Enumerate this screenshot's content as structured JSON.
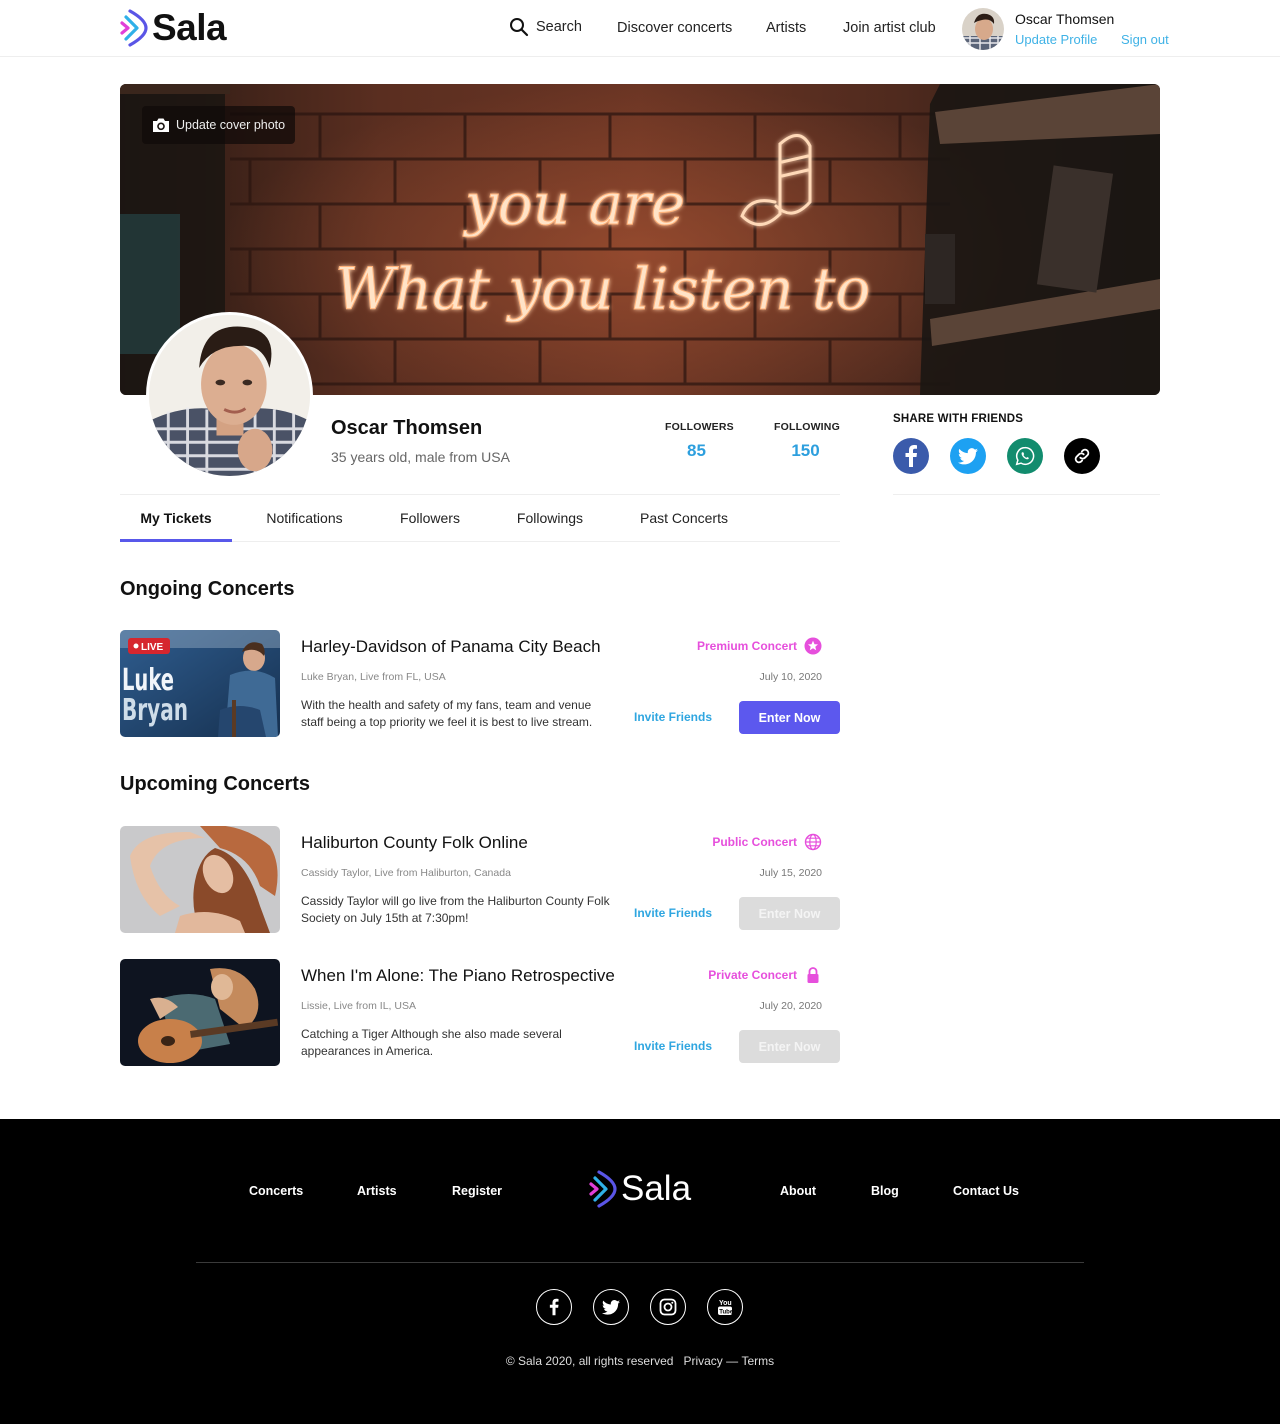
{
  "header": {
    "brand": "Sala",
    "search_label": "Search",
    "nav": [
      "Discover concerts",
      "Artists",
      "Join artist club"
    ],
    "user": {
      "name": "Oscar Thomsen",
      "update_profile": "Update Profile",
      "sign_out": "Sign out"
    }
  },
  "cover": {
    "update_label": "Update cover photo",
    "neon_line1": "you are",
    "neon_line2": "What you listen to"
  },
  "profile": {
    "name": "Oscar Thomsen",
    "subtitle": "35 years old, male from USA",
    "followers_label": "FOLLOWERS",
    "followers_value": "85",
    "following_label": "FOLLOWING",
    "following_value": "150"
  },
  "share": {
    "title": "SHARE WITH FRIENDS",
    "icons": [
      "facebook-icon",
      "twitter-icon",
      "whatsapp-icon",
      "link-icon"
    ]
  },
  "tabs": [
    {
      "label": "My Tickets",
      "active": true
    },
    {
      "label": "Notifications",
      "active": false
    },
    {
      "label": "Followers",
      "active": false
    },
    {
      "label": "Followings",
      "active": false
    },
    {
      "label": "Past Concerts",
      "active": false
    }
  ],
  "sections": {
    "ongoing_title": "Ongoing Concerts",
    "upcoming_title": "Upcoming Concerts"
  },
  "concerts": [
    {
      "title": "Harley-Davidson of Panama City Beach",
      "subtitle": "Luke Bryan, Live from FL, USA",
      "description": "With the health and safety of my fans, team and venue staff being a top priority we feel it is best to live stream.",
      "type": "Premium Concert",
      "type_icon": "star-icon",
      "date": "July 10, 2020",
      "invite_label": "Invite Friends",
      "enter_label": "Enter Now",
      "enabled": true,
      "thumb_badge": "LIVE",
      "thumb_text1": "Luke",
      "thumb_text2": "Bryan"
    },
    {
      "title": "Haliburton County Folk Online",
      "subtitle": "Cassidy Taylor, Live from Haliburton, Canada",
      "description": "Cassidy Taylor will go live from the Haliburton County Folk Society on July 15th at 7:30pm!",
      "type": "Public Concert",
      "type_icon": "globe-icon",
      "date": "July 15, 2020",
      "invite_label": "Invite Friends",
      "enter_label": "Enter Now",
      "enabled": false
    },
    {
      "title": "When I'm Alone: The Piano Retrospective",
      "subtitle": "Lissie, Live from IL, USA",
      "description": "Catching a Tiger Although she also made several appearances in America.",
      "type": "Private Concert",
      "type_icon": "lock-icon",
      "date": "July 20, 2020",
      "invite_label": "Invite Friends",
      "enter_label": "Enter Now",
      "enabled": false
    }
  ],
  "footer": {
    "links_left": [
      "Concerts",
      "Artists",
      "Register"
    ],
    "brand": "Sala",
    "links_right": [
      "About",
      "Blog",
      "Contact Us"
    ],
    "social": [
      "facebook-icon",
      "twitter-icon",
      "instagram-icon",
      "youtube-icon"
    ],
    "copyright": "© Sala 2020, all rights reserved",
    "privacy": "Privacy",
    "separator": "—",
    "terms": "Terms"
  },
  "colors": {
    "accent": "#5c58ee",
    "link_blue": "#2fa6e0",
    "concert_type_pink": "#e64fdc",
    "disabled": "#dcdcdc",
    "facebook": "#3b5bab",
    "twitter": "#1da1f2",
    "whatsapp": "#128c6e",
    "link_share": "#000000"
  }
}
